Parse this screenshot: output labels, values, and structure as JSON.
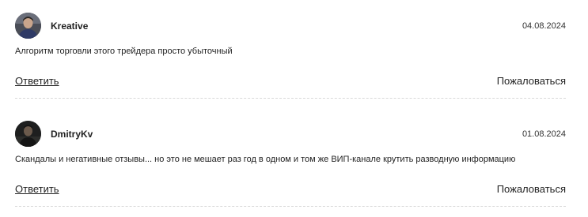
{
  "comments": [
    {
      "author": "Kreative",
      "date": "04.08.2024",
      "text": "Алгоритм торговли этого трейдера просто убыточный",
      "reply_label": "Ответить",
      "report_label": "Пожаловаться",
      "avatar_icon": "user-photo-avatar"
    },
    {
      "author": "DmitryKv",
      "date": "01.08.2024",
      "text": "Скандалы и негативные отзывы... но это не мешает раз год в одном и том же ВИП-канале крутить разводную информацию",
      "reply_label": "Ответить",
      "report_label": "Пожаловаться",
      "avatar_icon": "user-photo-avatar"
    }
  ]
}
